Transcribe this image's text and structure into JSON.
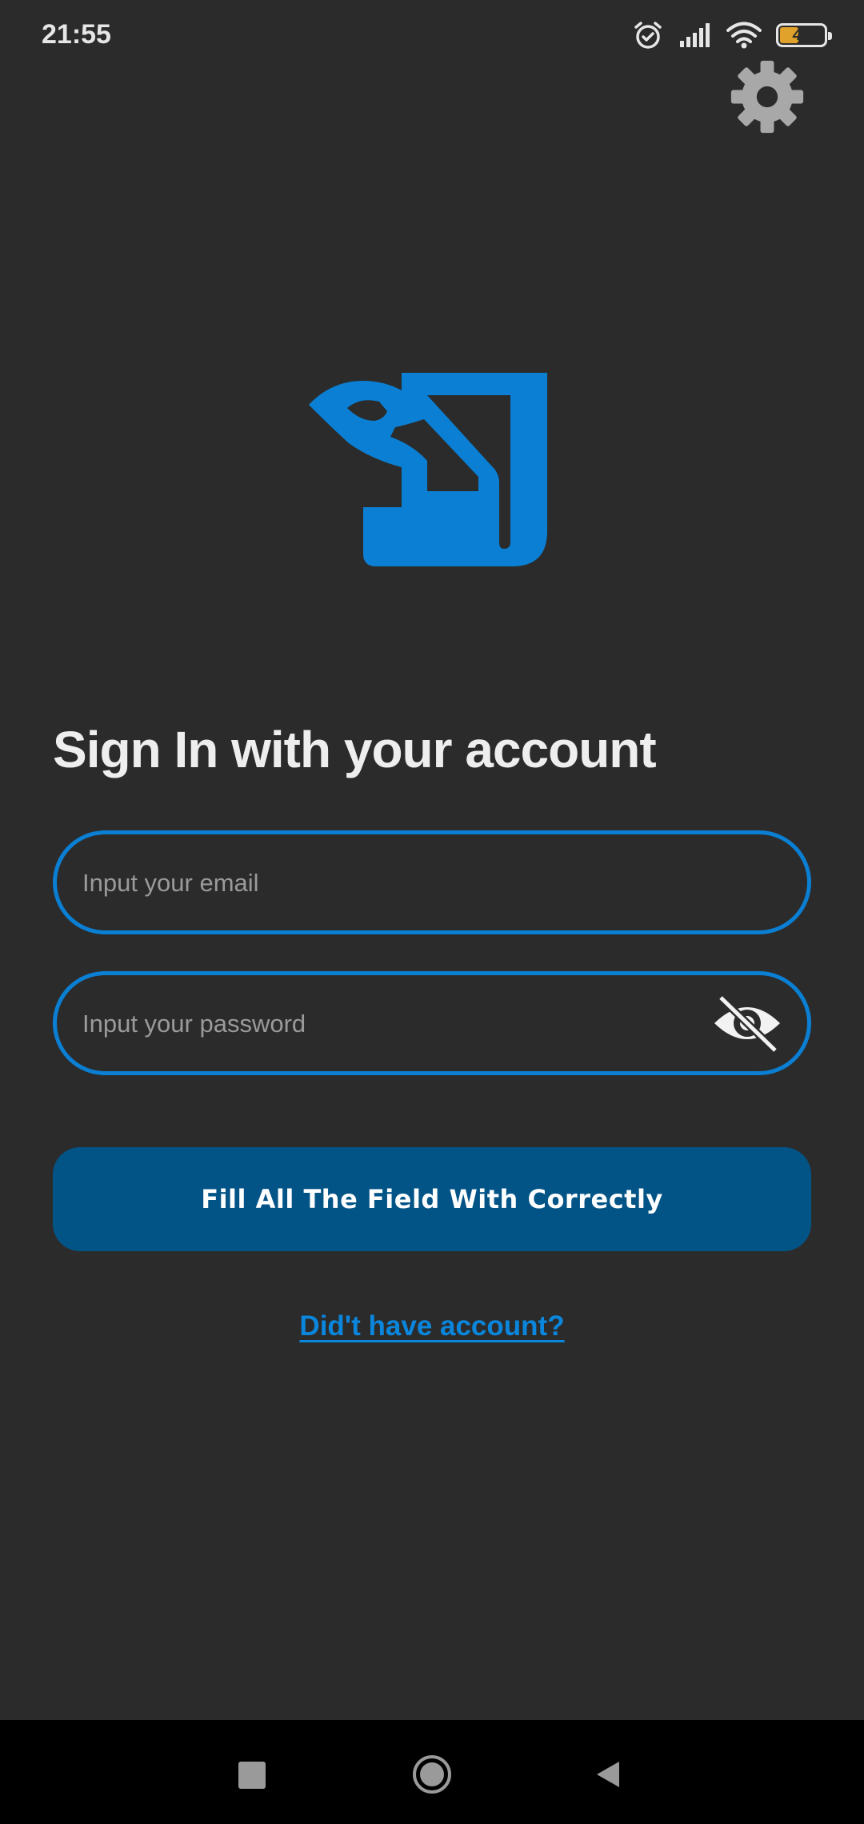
{
  "status_bar": {
    "time": "21:55",
    "battery_percent": "46",
    "battery_level": 0.46,
    "icons": [
      "alarm-icon",
      "signal-icon",
      "wifi-icon",
      "battery-icon"
    ]
  },
  "header": {
    "settings_icon": "gear-icon"
  },
  "logo": {
    "icon": "app-logo",
    "color": "#0a7fd4"
  },
  "form": {
    "title": "Sign In with your account",
    "email_placeholder": "Input your email",
    "email_value": "",
    "password_placeholder": "Input your password",
    "password_value": "",
    "password_toggle_icon": "eye-slash-icon",
    "submit_label": "Fill All The Field With Correctly",
    "signup_link": "Did't have account?"
  },
  "nav_bar": {
    "buttons": [
      "recents-icon",
      "home-icon",
      "back-icon"
    ]
  },
  "colors": {
    "background": "#2b2b2b",
    "accent": "#0a7fd4",
    "button": "#025487",
    "link": "#0a86dc"
  }
}
